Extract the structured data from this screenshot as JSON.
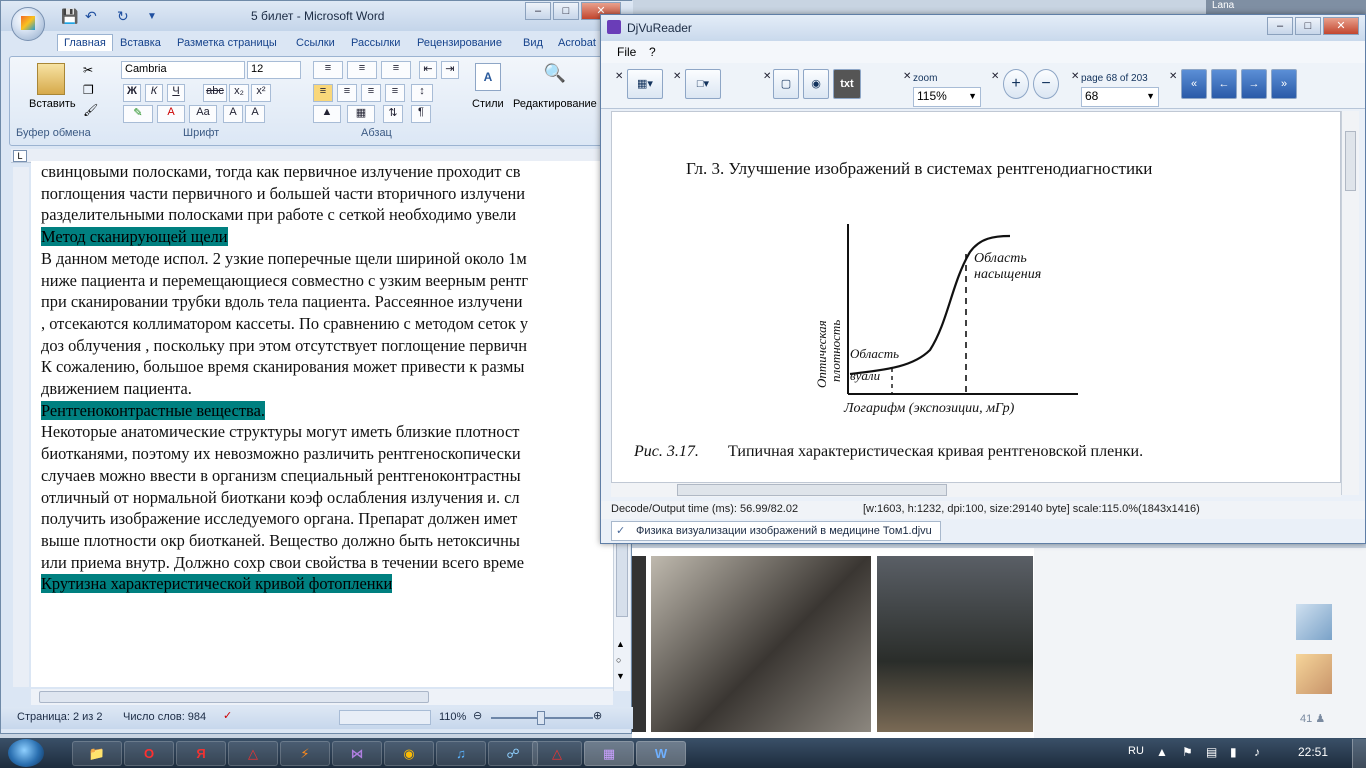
{
  "word": {
    "window_title": "5 билет - Microsoft Word",
    "tabs": [
      "Главная",
      "Вставка",
      "Разметка страницы",
      "Ссылки",
      "Рассылки",
      "Рецензирование",
      "Вид",
      "Acrobat"
    ],
    "active_tab": "Главная",
    "ribbon": {
      "paste_label": "Вставить",
      "clipboard_group": "Буфер обмена",
      "font_name": "Cambria",
      "font_size": "12",
      "font_group": "Шрифт",
      "paragraph_group": "Абзац",
      "styles_label": "Стили",
      "editing_label": "Редактирование"
    },
    "document_lines": [
      {
        "text": "свинцовыми полосками, тогда как первичное излучение проходит св",
        "style": "normal"
      },
      {
        "text": "поглощения части первичного и большей части вторичного излучени",
        "style": "normal"
      },
      {
        "text": "разделительными полосками при работе с сеткой необходимо увели",
        "style": "normal"
      },
      {
        "text": "Метод сканирующей щели",
        "style": "heading"
      },
      {
        "text": "В данном методе испол. 2 узкие поперечные щели шириной около 1м",
        "style": "normal"
      },
      {
        "text": "ниже пациента и перемещающиеся совместно с узким веерным рентг",
        "style": "normal"
      },
      {
        "text": "при сканировании трубки вдоль тела пациента. Рассеянное излучени",
        "style": "normal"
      },
      {
        "text": ", отсекаются коллиматором кассеты. По сравнению с методом сеток у",
        "style": "normal"
      },
      {
        "text": "доз облучения , поскольку при этом отсутствует поглощение первичн",
        "style": "normal"
      },
      {
        "text": "К сожалению, большое время сканирования может привести к размы",
        "style": "normal"
      },
      {
        "text": "движением пациента.",
        "style": "normal"
      },
      {
        "text": "Рентгеноконтрастные вещества.",
        "style": "heading"
      },
      {
        "text": "Некоторые анатомические структуры могут иметь близкие плотност",
        "style": "normal"
      },
      {
        "text": "биотканями, поэтому их невозможно различить рентгеноскопически",
        "style": "normal"
      },
      {
        "text": "случаев можно ввести в организм специальный рентгеноконтрастны",
        "style": "normal"
      },
      {
        "text": "отличный от нормальной биоткани коэф ослабления излучения и. сл",
        "style": "normal"
      },
      {
        "text": "получить изображение исследуемого органа. Препарат должен имет",
        "style": "normal"
      },
      {
        "text": "выше плотности окр биотканей. Вещество должно быть нетоксичны",
        "style": "normal"
      },
      {
        "text": "или приема внутр. Должно сохр свои свойства в течении всего време",
        "style": "normal"
      },
      {
        "text": "Крутизна характеристической кривой фотопленки",
        "style": "heading"
      }
    ],
    "status": {
      "page": "Страница: 2 из 2",
      "words": "Число слов: 984",
      "zoom": "110%"
    }
  },
  "djvu": {
    "window_title": "DjVuReader",
    "menu": [
      "File",
      "?"
    ],
    "zoom_label": "zoom",
    "zoom_value": "115%",
    "page_label": "page 68 of 203",
    "page_value": "68",
    "tool_text_label": "txt",
    "scan": {
      "header": "Гл. 3. Улучшение изображений в системах рентгенодиагностики",
      "label_saturation_1": "Область",
      "label_saturation_2": "насыщения",
      "label_fog_1": "Область",
      "label_fog_2": "вуали",
      "y_axis_1": "Оптическая",
      "y_axis_2": "плотность",
      "x_axis": "Логарифм (экспозиции, мГр)",
      "caption_num": "Рис. 3.17.",
      "caption_text": "Типичная характеристическая кривая рентгеновской пленки."
    },
    "status_left": "Decode/Output time (ms): 56.99/82.02",
    "status_right": "[w:1603, h:1232, dpi:100, size:29140 byte] scale:115.0%(1843x1416)",
    "doc_tab": "Физика визуализации изображений в медицине Том1.djvu"
  },
  "background": {
    "user_name": "Lana",
    "friends_count": "41"
  },
  "taskbar": {
    "lang": "RU",
    "clock": "22:51",
    "apps": [
      "explorer",
      "opera",
      "yandex",
      "acrobat",
      "winamp",
      "vs",
      "chrome",
      "itunes",
      "network",
      "pdf",
      "djvu",
      "word"
    ]
  }
}
